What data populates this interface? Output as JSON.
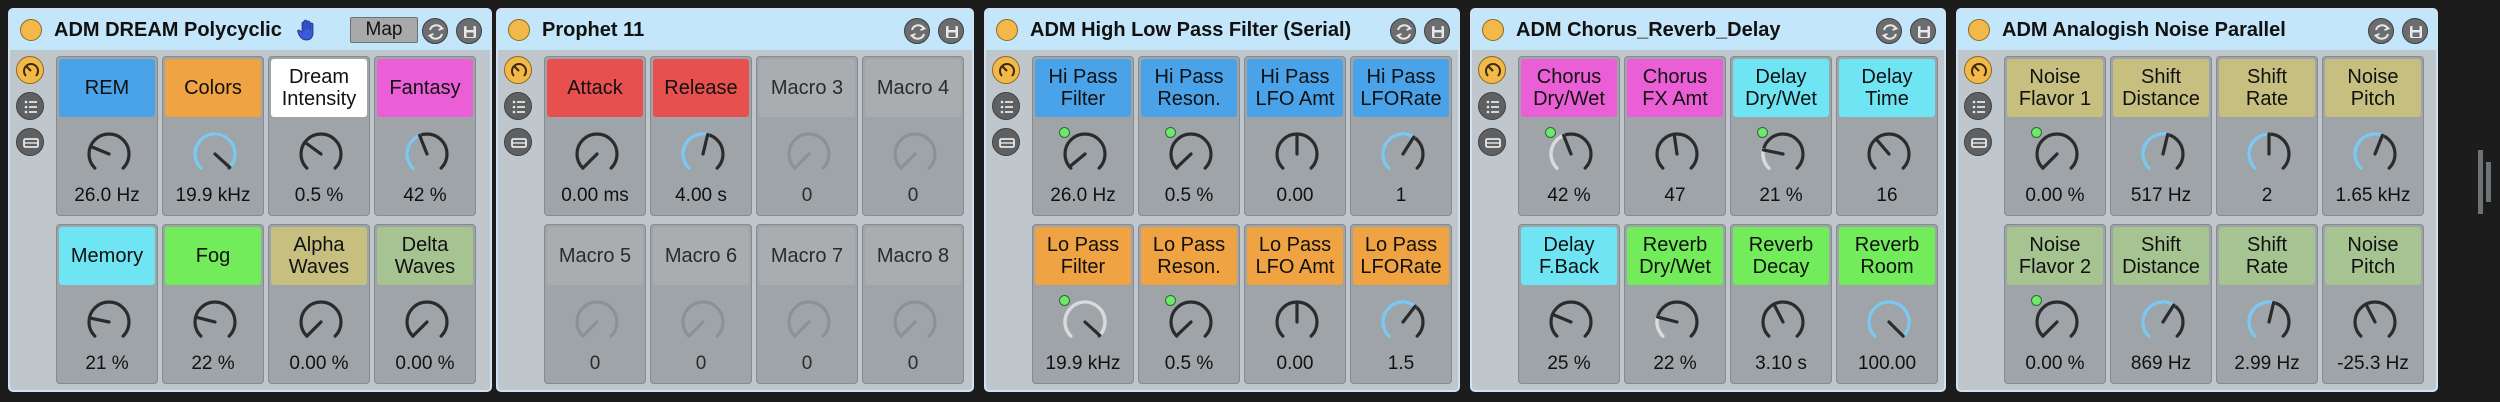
{
  "colors": {
    "blue": "#4aa3e8",
    "orange": "#f0a342",
    "white": "#ffffff",
    "magenta": "#ea5fd6",
    "cyan": "#6fe4f2",
    "green": "#72ec5a",
    "olive": "#c6bf80",
    "sage": "#a6c392",
    "red": "#e85050",
    "grey": "#a9adb0",
    "arc_active": "#7fc7ee",
    "arc_muted": "#d8dadc",
    "header_bg": "#c4e6fb",
    "power": "#f2b84a"
  },
  "devices": [
    {
      "title": "ADM DREAM Polycyclic",
      "map_label": "Map",
      "has_hand": true,
      "macros": [
        {
          "label": "REM",
          "value": "26.0 Hz",
          "color": "blue",
          "fraction": 0.25
        },
        {
          "label": "Colors",
          "value": "19.9 kHz",
          "color": "orange",
          "fraction": 0.99,
          "arc": true
        },
        {
          "label": "Dream\nIntensity",
          "value": "0.5 %",
          "color": "white",
          "fraction": 0.3
        },
        {
          "label": "Fantasy",
          "value": "42 %",
          "color": "magenta",
          "fraction": 0.42,
          "arc": true
        },
        {
          "label": "Memory",
          "value": "21 %",
          "color": "cyan",
          "fraction": 0.21
        },
        {
          "label": "Fog",
          "value": "22 %",
          "color": "green",
          "fraction": 0.22
        },
        {
          "label": "Alpha\nWaves",
          "value": "0.00 %",
          "color": "olive",
          "fraction": 0.0
        },
        {
          "label": "Delta\nWaves",
          "value": "0.00 %",
          "color": "sage",
          "fraction": 0.0
        }
      ]
    },
    {
      "title": "Prophet 11",
      "macros": [
        {
          "label": "Attack",
          "value": "0.00 ms",
          "color": "red",
          "fraction": 0.0
        },
        {
          "label": "Release",
          "value": "4.00 s",
          "color": "red",
          "fraction": 0.55,
          "arc": true
        },
        {
          "label": "Macro 3",
          "value": "0",
          "color": "grey",
          "fraction": 0.0,
          "muted": true
        },
        {
          "label": "Macro 4",
          "value": "0",
          "color": "grey",
          "fraction": 0.0,
          "muted": true
        },
        {
          "label": "Macro 5",
          "value": "0",
          "color": "grey",
          "fraction": 0.0,
          "muted": true
        },
        {
          "label": "Macro 6",
          "value": "0",
          "color": "grey",
          "fraction": 0.0,
          "muted": true
        },
        {
          "label": "Macro 7",
          "value": "0",
          "color": "grey",
          "fraction": 0.0,
          "muted": true
        },
        {
          "label": "Macro 8",
          "value": "0",
          "color": "grey",
          "fraction": 0.0,
          "muted": true
        }
      ]
    },
    {
      "title": "ADM High Low Pass Filter (Serial)",
      "macros": [
        {
          "label": "Hi Pass\nFilter",
          "value": "26.0 Hz",
          "color": "blue",
          "fraction": 0.02,
          "dot": true
        },
        {
          "label": "Hi Pass\nReson.",
          "value": "0.5 %",
          "color": "blue",
          "fraction": 0.005,
          "dot": true
        },
        {
          "label": "Hi Pass\nLFO Amt",
          "value": "0.00",
          "color": "blue",
          "fraction": 0.5
        },
        {
          "label": "Hi Pass\nLFORate",
          "value": "1",
          "color": "blue",
          "fraction": 0.62,
          "arc": true
        },
        {
          "label": "Lo Pass\nFilter",
          "value": "19.9 kHz",
          "color": "orange",
          "fraction": 0.99,
          "dot": true,
          "arc": true,
          "arcMuted": true
        },
        {
          "label": "Lo Pass\nReson.",
          "value": "0.5 %",
          "color": "orange",
          "fraction": 0.005,
          "dot": true
        },
        {
          "label": "Lo Pass\nLFO Amt",
          "value": "0.00",
          "color": "orange",
          "fraction": 0.5
        },
        {
          "label": "Lo Pass\nLFORate",
          "value": "1.5",
          "color": "orange",
          "fraction": 0.64,
          "arc": true
        }
      ]
    },
    {
      "title": "ADM Chorus_Reverb_Delay",
      "macros": [
        {
          "label": "Chorus\nDry/Wet",
          "value": "42 %",
          "color": "magenta",
          "fraction": 0.42,
          "dot": true,
          "arc": true,
          "arcMuted": true
        },
        {
          "label": "Chorus\nFX Amt",
          "value": "47",
          "color": "magenta",
          "fraction": 0.47
        },
        {
          "label": "Delay\nDry/Wet",
          "value": "21 %",
          "color": "cyan",
          "fraction": 0.21,
          "dot": true,
          "arc": true,
          "arcMuted": true
        },
        {
          "label": "Delay\nTime",
          "value": "16",
          "color": "cyan",
          "fraction": 0.35
        },
        {
          "label": "Delay\nF.Back",
          "value": "25 %",
          "color": "cyan",
          "fraction": 0.25
        },
        {
          "label": "Reverb\nDry/Wet",
          "value": "22 %",
          "color": "green",
          "fraction": 0.22,
          "arc": true,
          "arcMuted": true
        },
        {
          "label": "Reverb\nDecay",
          "value": "3.10 s",
          "color": "green",
          "fraction": 0.4
        },
        {
          "label": "Reverb\nRoom",
          "value": "100.00",
          "color": "green",
          "fraction": 1.0,
          "arc": true
        }
      ]
    },
    {
      "title": "ADM Analogish Noise Parallel",
      "macros": [
        {
          "label": "Noise\nFlavor 1",
          "value": "0.00 %",
          "color": "olive",
          "fraction": 0.0,
          "dot": true
        },
        {
          "label": "Shift\nDistance",
          "value": "517 Hz",
          "color": "olive",
          "fraction": 0.55,
          "arc": true
        },
        {
          "label": "Shift\nRate",
          "value": "2",
          "color": "olive",
          "fraction": 0.5,
          "arc": true
        },
        {
          "label": "Noise\nPitch",
          "value": "1.65 kHz",
          "color": "olive",
          "fraction": 0.58,
          "arc": true
        },
        {
          "label": "Noise\nFlavor 2",
          "value": "0.00 %",
          "color": "sage",
          "fraction": 0.0,
          "dot": true
        },
        {
          "label": "Shift\nDistance",
          "value": "869 Hz",
          "color": "sage",
          "fraction": 0.62,
          "arc": true
        },
        {
          "label": "Shift\nRate",
          "value": "2.99 Hz",
          "color": "sage",
          "fraction": 0.55,
          "arc": true
        },
        {
          "label": "Noise\nPitch",
          "value": "-25.3 Hz",
          "color": "sage",
          "fraction": 0.4
        }
      ]
    }
  ]
}
